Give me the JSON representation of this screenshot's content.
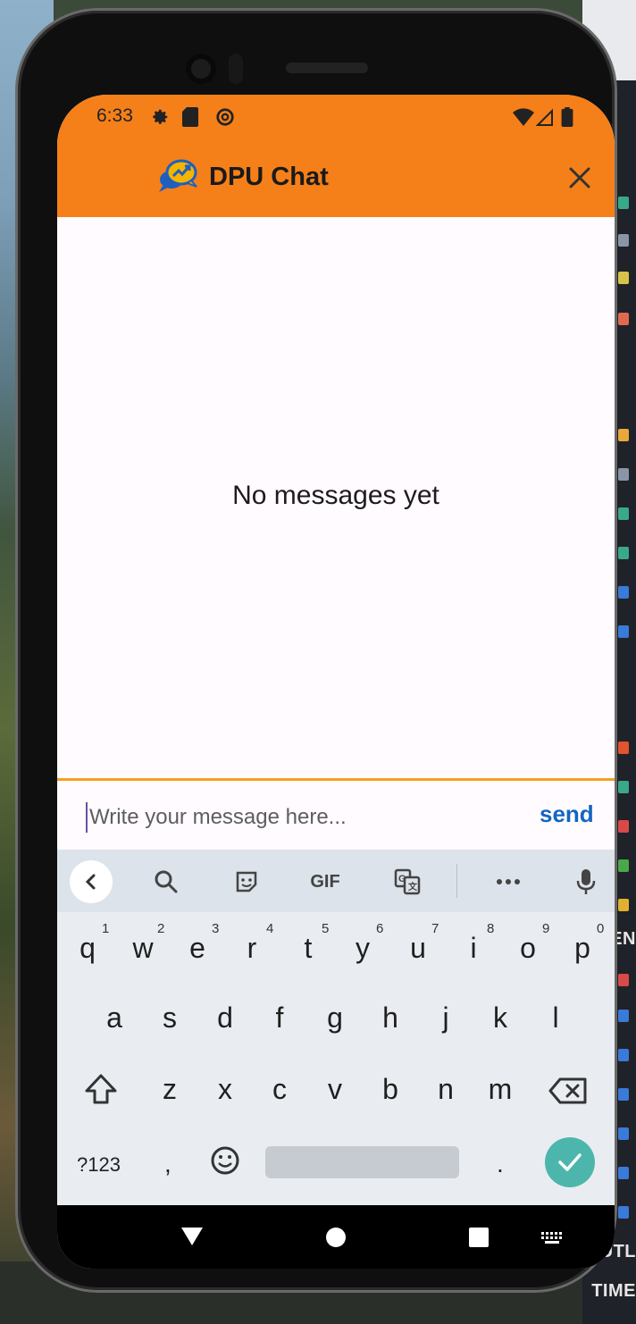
{
  "status": {
    "time": "6:33"
  },
  "app": {
    "title": "DPU Chat",
    "close_label": "×"
  },
  "chat": {
    "empty_text": "No messages yet"
  },
  "composer": {
    "placeholder": "Write your message here...",
    "send_label": "send"
  },
  "keyboard": {
    "toolbar": {
      "gif_label": "GIF"
    },
    "row1": [
      {
        "k": "q",
        "h": "1"
      },
      {
        "k": "w",
        "h": "2"
      },
      {
        "k": "e",
        "h": "3"
      },
      {
        "k": "r",
        "h": "4"
      },
      {
        "k": "t",
        "h": "5"
      },
      {
        "k": "y",
        "h": "6"
      },
      {
        "k": "u",
        "h": "7"
      },
      {
        "k": "i",
        "h": "8"
      },
      {
        "k": "o",
        "h": "9"
      },
      {
        "k": "p",
        "h": "0"
      }
    ],
    "row2": [
      "a",
      "s",
      "d",
      "f",
      "g",
      "h",
      "j",
      "k",
      "l"
    ],
    "row3": [
      "z",
      "x",
      "c",
      "v",
      "b",
      "n",
      "m"
    ],
    "symbols_label": "?123",
    "comma_label": ",",
    "period_label": "."
  },
  "desktop": {
    "side_labels": [
      "OUTL",
      "TIME",
      "EN"
    ]
  },
  "colors": {
    "app_bar": "#f58019",
    "send": "#1565c0",
    "enter_key": "#4db6ac",
    "divider": "#f5a020"
  }
}
